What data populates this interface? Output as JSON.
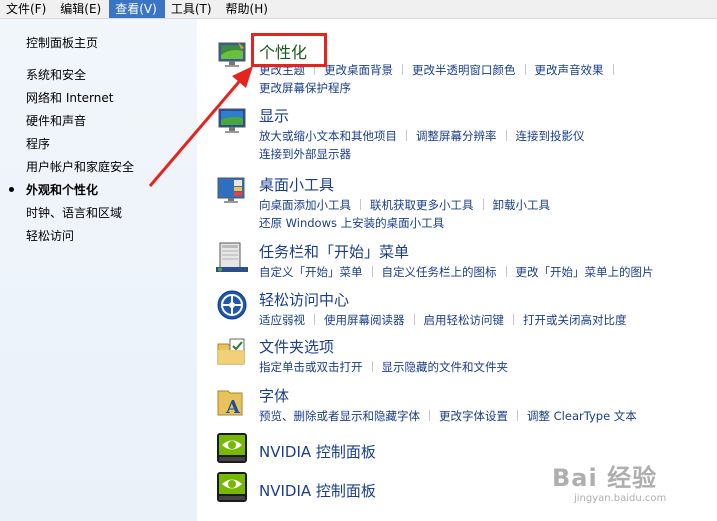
{
  "menubar": [
    {
      "label": "文件(F)",
      "active": false
    },
    {
      "label": "编辑(E)",
      "active": false
    },
    {
      "label": "查看(V)",
      "active": true
    },
    {
      "label": "工具(T)",
      "active": false
    },
    {
      "label": "帮助(H)",
      "active": false
    }
  ],
  "sidebar": {
    "home": "控制面板主页",
    "items": [
      "系统和安全",
      "网络和 Internet",
      "硬件和声音",
      "程序",
      "用户帐户和家庭安全",
      "外观和个性化",
      "时钟、语言和区域",
      "轻松访问"
    ],
    "active_index": 5
  },
  "categories": [
    {
      "title": "个性化",
      "icon": "personalization-icon",
      "links": [
        "更改主题",
        "更改桌面背景",
        "更改半透明窗口颜色",
        "更改声音效果",
        "更改屏幕保护程序"
      ]
    },
    {
      "title": "显示",
      "icon": "display-icon",
      "links": [
        "放大或缩小文本和其他项目",
        "调整屏幕分辨率",
        "连接到投影仪",
        "连接到外部显示器"
      ]
    },
    {
      "title": "桌面小工具",
      "icon": "gadgets-icon",
      "links": [
        "向桌面添加小工具",
        "联机获取更多小工具",
        "卸载小工具",
        "还原 Windows 上安装的桌面小工具"
      ]
    },
    {
      "title": "任务栏和「开始」菜单",
      "icon": "taskbar-icon",
      "links": [
        "自定义「开始」菜单",
        "自定义任务栏上的图标",
        "更改「开始」菜单上的图片"
      ]
    },
    {
      "title": "轻松访问中心",
      "icon": "ease-of-access-icon",
      "links": [
        "适应弱视",
        "使用屏幕阅读器",
        "启用轻松访问键",
        "打开或关闭高对比度"
      ]
    },
    {
      "title": "文件夹选项",
      "icon": "folder-options-icon",
      "links": [
        "指定单击或双击打开",
        "显示隐藏的文件和文件夹"
      ]
    },
    {
      "title": "字体",
      "icon": "fonts-icon",
      "links": [
        "预览、删除或者显示和隐藏字体",
        "更改字体设置",
        "调整 ClearType 文本"
      ]
    },
    {
      "title": "NVIDIA 控制面板",
      "icon": "nvidia-icon",
      "links": []
    },
    {
      "title": "NVIDIA 控制面板",
      "icon": "nvidia-icon",
      "links": []
    }
  ],
  "watermark": {
    "main": "Bai 经验",
    "sub": "jingyan.baidu.com"
  },
  "colors": {
    "highlight": "#e52420",
    "link": "#1a3e8a",
    "menu_active": "#3a74c4",
    "sidebar_bg": "#eef4fa"
  }
}
